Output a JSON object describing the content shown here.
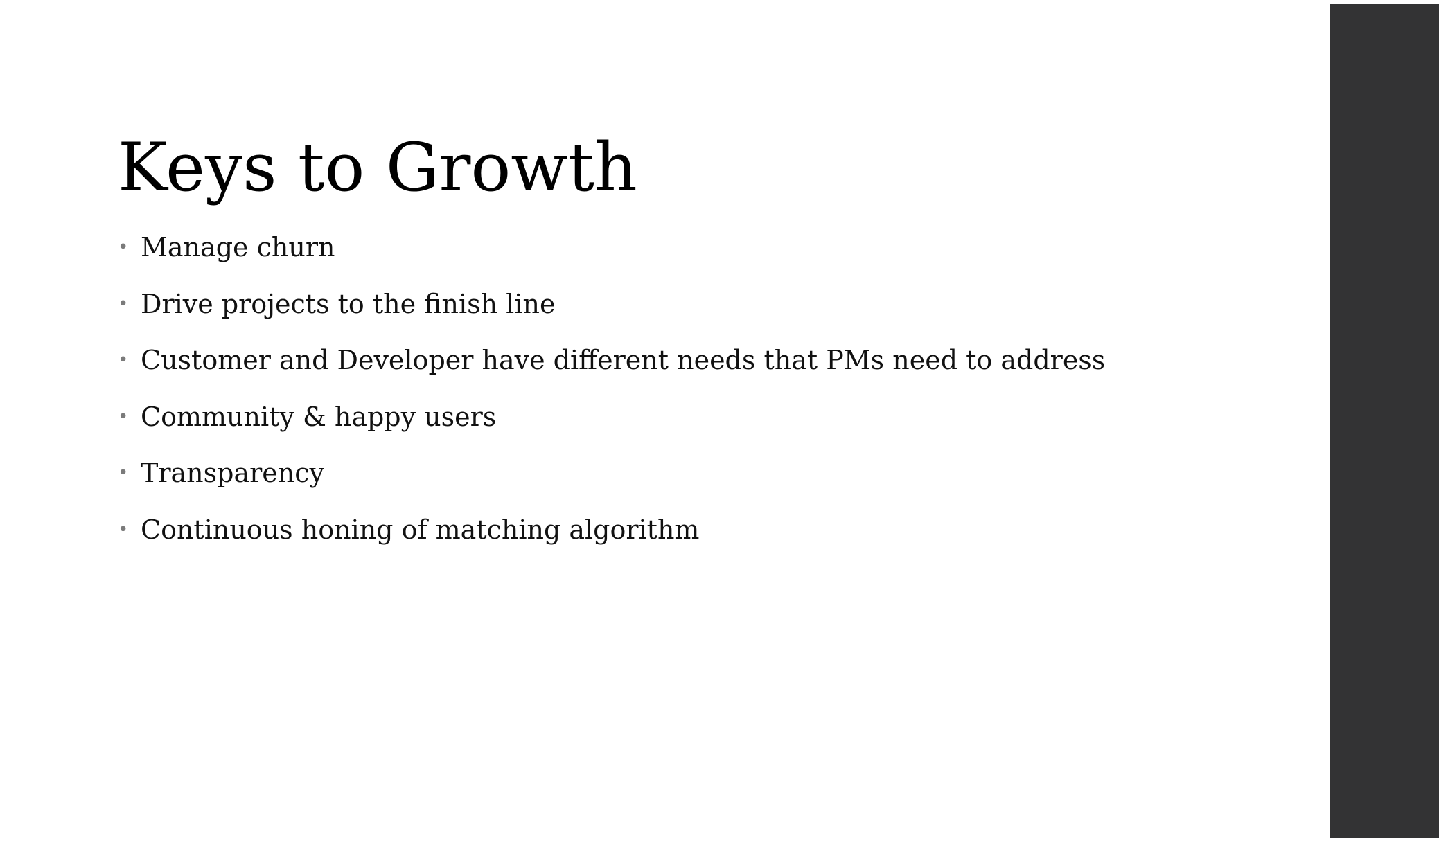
{
  "slide": {
    "title": "Keys to Growth",
    "bullets": [
      "Manage churn",
      "Drive projects to the finish line",
      "Customer and Developer have different needs that PMs need to address",
      "Community & happy users",
      "Transparency",
      "Continuous honing of matching algorithm"
    ],
    "bullet_glyph": "•",
    "colors": {
      "background": "#ffffff",
      "side_bar": "#333334",
      "text": "#111111",
      "bullet": "#7b7b7b"
    }
  }
}
